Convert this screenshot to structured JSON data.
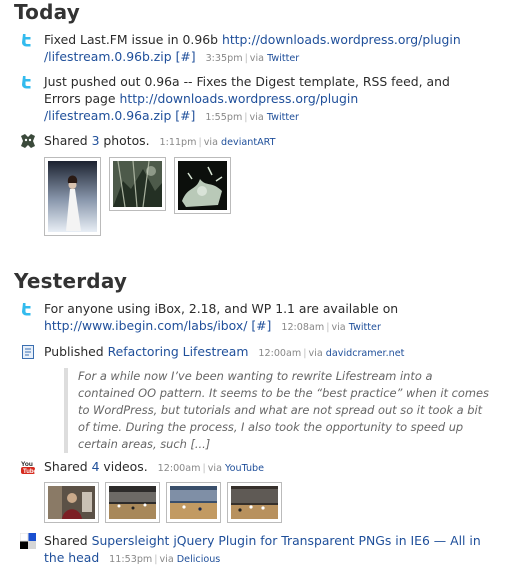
{
  "today": {
    "title": "Today",
    "entries": [
      {
        "text": "Fixed Last.FM issue in 0.96b",
        "link": "http://downloads.wordpress.org/plugin/lifestream.0.96b.zip",
        "link_line1": "http://downloads.wordpress.org/plugin",
        "link_line2": "/lifestream.0.96b.zip",
        "hash": "[#]",
        "time": "3:35pm",
        "via": "via",
        "source": "Twitter"
      },
      {
        "text_line1": "Just pushed out 0.96a -- Fixes the Digest template, RSS feed, and",
        "text_line2": "Errors page",
        "link_line1": "http://downloads.wordpress.org/plugin",
        "link_line2": "/lifestream.0.96a.zip",
        "hash": "[#]",
        "time": "1:55pm",
        "via": "via",
        "source": "Twitter"
      },
      {
        "prefix": "Shared",
        "count": "3",
        "suffix": "photos.",
        "time": "1:11pm",
        "via": "via",
        "source": "deviantART"
      }
    ]
  },
  "yesterday": {
    "title": "Yesterday",
    "entries": [
      {
        "text_line1": "For anyone using iBox, 2.18, and WP 1.1 are available on",
        "link": "http://www.ibegin.com/labs/ibox/",
        "hash": "[#]",
        "time": "12:08am",
        "via": "via",
        "source": "Twitter"
      },
      {
        "prefix": "Published",
        "title": "Refactoring Lifestream",
        "time": "12:00am",
        "via": "via",
        "source": "davidcramer.net",
        "excerpt": "For a while now I’ve been wanting to rewrite Lifestream into a contained OO pattern. It seems to be the “best practice” when it comes to WordPress, but tutorials and what are not spread out so it took a bit of time. During the process, I also took the opportunity to speed up certain areas, such [...]"
      },
      {
        "prefix": "Shared",
        "count": "4",
        "suffix": "videos.",
        "time": "12:00am",
        "via": "via",
        "source": "YouTube"
      },
      {
        "prefix": "Shared",
        "title_line1": "Supersleight jQuery Plugin for Transparent PNGs in IE6 — All in",
        "title_line2": "the head",
        "time": "11:53pm",
        "via": "via",
        "source": "Delicious"
      }
    ]
  },
  "separator": "|",
  "icons": {
    "twitter": "twitter-icon",
    "deviantart": "deviantart-icon",
    "blog": "document-icon",
    "youtube": "youtube-icon",
    "delicious": "delicious-icon"
  },
  "colors": {
    "link": "#1f4f9a",
    "twitter": "#33bbee",
    "delicious": "#1a4fd0"
  }
}
